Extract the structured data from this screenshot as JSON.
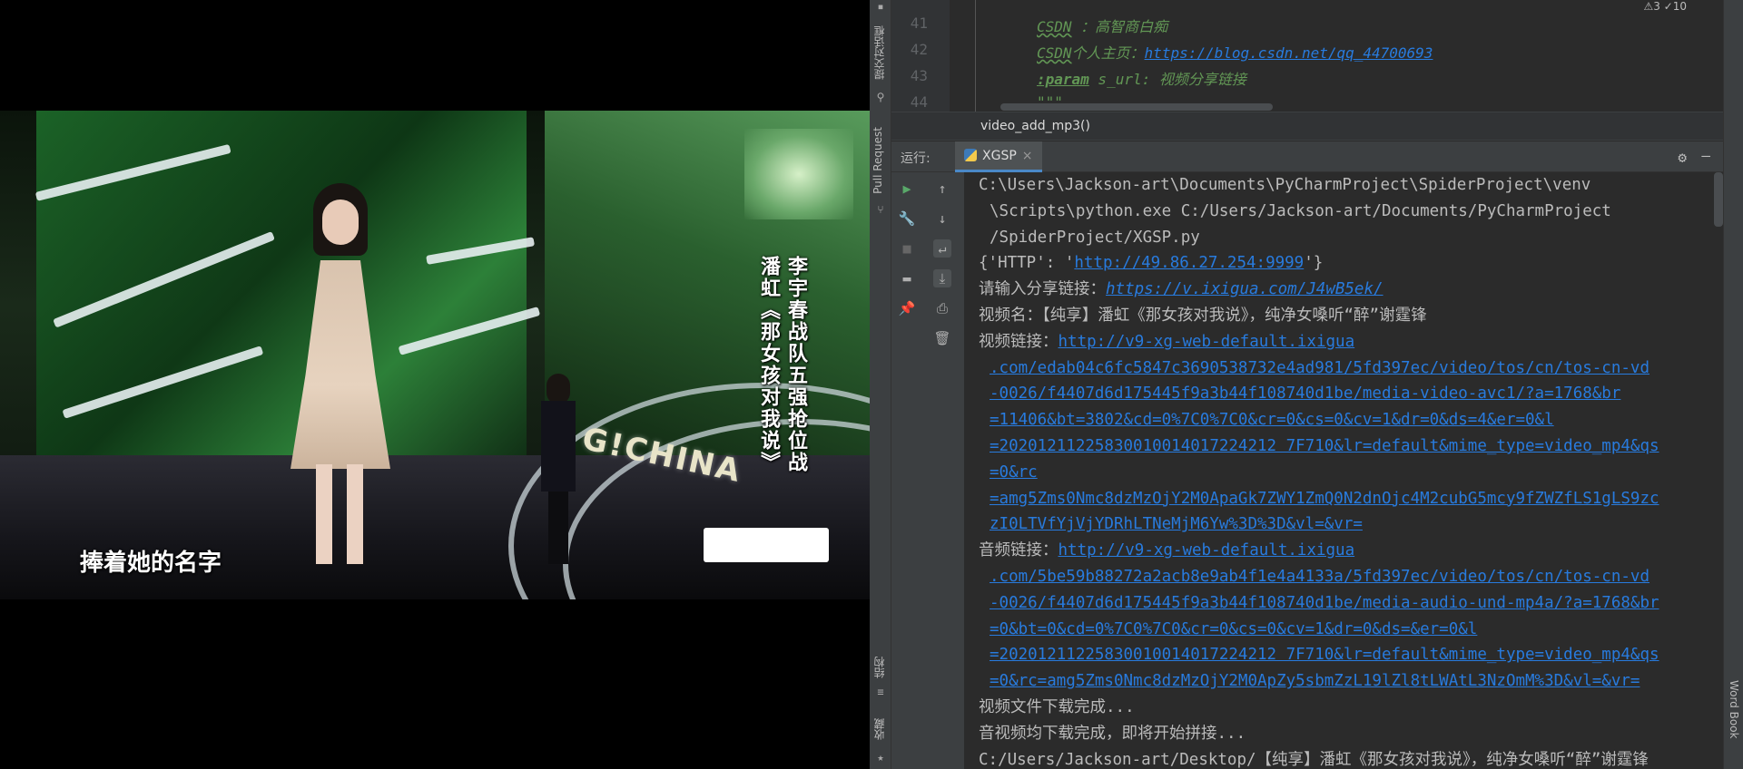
{
  "video": {
    "caption_left": "潘虹《那女孩对我说》",
    "caption_right": "李宇春战队五强抢位战",
    "subtitle": "捧着她的名字",
    "stage_logo": "G!CHINA"
  },
  "ide": {
    "left_strip": {
      "commit": "提交对话框",
      "pull_request": "Pull Request",
      "structure": "结构",
      "favorites": "收藏"
    },
    "right_strip": {
      "word_book": "Word Book"
    },
    "editor": {
      "lines": [
        {
          "no": "41",
          "tag": "CSDN",
          "text": " ：高智商白痴"
        },
        {
          "no": "42",
          "tag": "CSDN",
          "text": "个人主页：",
          "link": "https://blog.csdn.net/qq_44700693"
        },
        {
          "no": "43",
          "tag": ":param",
          "text": " s_url: 视频分享链接"
        },
        {
          "no": "44",
          "tag": "",
          "text": "\"\"\""
        }
      ],
      "warnings": "⚠3 ✓10"
    },
    "breadcrumb": "video_add_mp3()",
    "run": {
      "label": "运行:",
      "tab": "XGSP"
    },
    "console": [
      {
        "text": "C:\\Users\\Jackson-art\\Documents\\PyCharmProject\\SpiderProject\\venv"
      },
      {
        "text": "\\Scripts\\python.exe C:/Users/Jackson-art/Documents/PyCharmProject",
        "indent": true
      },
      {
        "text": "/SpiderProject/XGSP.py",
        "indent": true
      },
      {
        "prefix": "{'HTTP': '",
        "link": "http://49.86.27.254:9999",
        "suffix": "'}"
      },
      {
        "prefix": "请输入分享链接：",
        "ilink": "https://v.ixigua.com/J4wB5ek/"
      },
      {
        "text": "视频名：【纯享】潘虹《那女孩对我说》，纯净女嗓听“醉”谢霆锋"
      },
      {
        "prefix": "视频链接：",
        "link": "http://v9-xg-web-default.ixigua"
      },
      {
        "link": ".com/edab04c6fc5847c3690538732e4ad981/5fd397ec/video/tos/cn/tos-cn-vd",
        "indent": true
      },
      {
        "link": "-0026/f4407d6d175445f9a3b44f108740d1be/media-video-avc1/?a=1768&br",
        "indent": true
      },
      {
        "link": "=11406&bt=3802&cd=0%7C0%7C0&cr=0&cs=0&cv=1&dr=0&ds=4&er=0&l",
        "indent": true
      },
      {
        "link": "=20201211225830010014017224212 7F710&lr=default&mime_type=video_mp4&qs",
        "indent": true
      },
      {
        "link": "=0&rc",
        "indent": true
      },
      {
        "link": "=amg5Zms0Nmc8dzMzOjY2M0ApaGk7ZWY1ZmQ0N2dnOjc4M2cubG5mcy9fZWZfLS1gLS9zc",
        "indent": true
      },
      {
        "link": "zI0LTVfYjVjYDRhLTNeMjM6Yw%3D%3D&vl=&vr=",
        "indent": true
      },
      {
        "prefix": "音频链接：",
        "link": "http://v9-xg-web-default.ixigua"
      },
      {
        "link": ".com/5be59b88272a2acb8e9ab4f1e4a4133a/5fd397ec/video/tos/cn/tos-cn-vd",
        "indent": true
      },
      {
        "link": "-0026/f4407d6d175445f9a3b44f108740d1be/media-audio-und-mp4a/?a=1768&br",
        "indent": true
      },
      {
        "link": "=0&bt=0&cd=0%7C0%7C0&cr=0&cs=0&cv=1&dr=0&ds=&er=0&l",
        "indent": true
      },
      {
        "link": "=20201211225830010014017224212 7F710&lr=default&mime_type=video_mp4&qs",
        "indent": true
      },
      {
        "link": "=0&rc=amg5Zms0Nmc8dzMzOjY2M0ApZy5sbmZzL19lZl8tLWAtL3NzOmM%3D&vl=&vr=",
        "indent": true
      },
      {
        "text": "视频文件下载完成..."
      },
      {
        "text": "音视频均下载完成，即将开始拼接..."
      },
      {
        "text": "C:/Users/Jackson-art/Desktop/【纯享】潘虹《那女孩对我说》，纯净女嗓听“醉”谢霆锋"
      }
    ]
  }
}
